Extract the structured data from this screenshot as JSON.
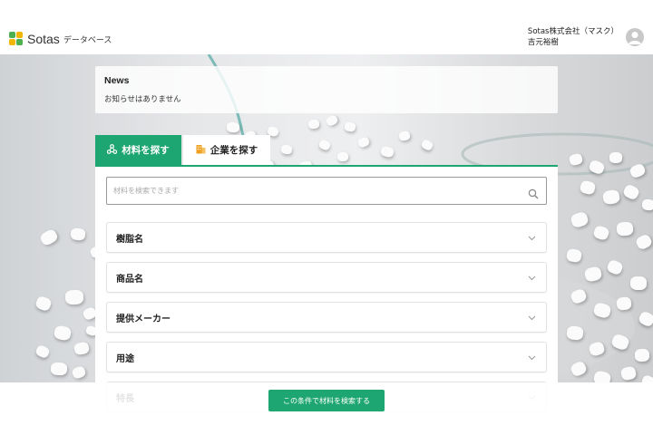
{
  "header": {
    "logo_name": "Sotas",
    "logo_sub": "データベース",
    "company": "Sotas株式会社（マスク）",
    "user_name": "吉元裕樹"
  },
  "news": {
    "title": "News",
    "body": "お知らせはありません"
  },
  "tabs": [
    {
      "label": "材料を探す",
      "icon": "molecule-icon",
      "active": true
    },
    {
      "label": "企業を探す",
      "icon": "building-icon",
      "active": false
    }
  ],
  "search": {
    "placeholder": "材料を検索できます",
    "value": ""
  },
  "filters": [
    {
      "label": "樹脂名"
    },
    {
      "label": "商品名"
    },
    {
      "label": "提供メーカー"
    },
    {
      "label": "用途"
    },
    {
      "label": "特長"
    }
  ],
  "cta": {
    "label": "この条件で材料を検索する"
  },
  "colors": {
    "accent": "#1da671",
    "logo_green": "#4caf50",
    "logo_yellow": "#f2b705",
    "building_icon": "#f0a020"
  }
}
